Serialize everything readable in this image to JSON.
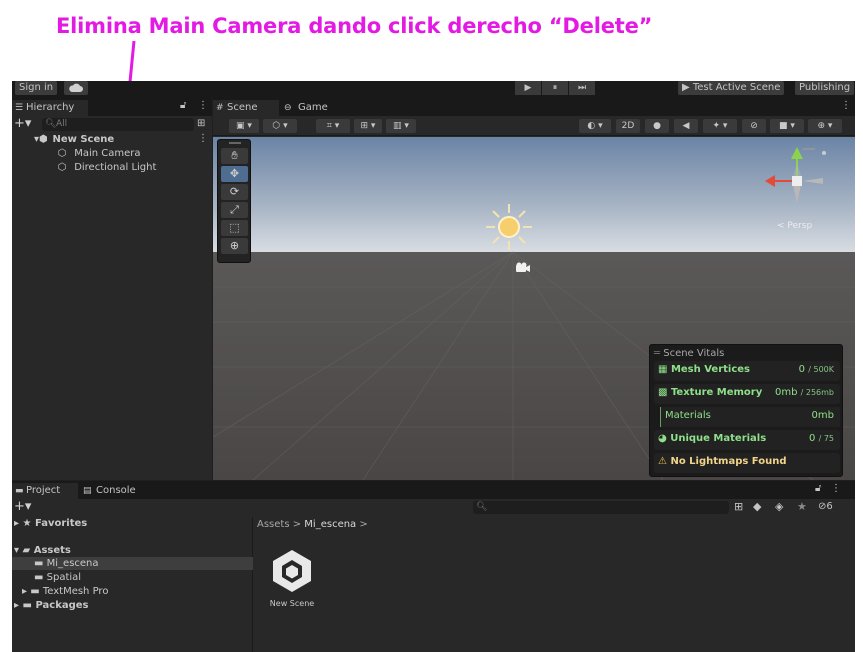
{
  "annotation": {
    "text": "Elimina Main Camera dando click derecho “Delete”",
    "color": "#e31ae3"
  },
  "toolbar": {
    "sign_in": "Sign in",
    "cloud_icon": "cloud-icon",
    "play_icon": "▶",
    "pause_icon": "⏸",
    "step_icon": "⏭",
    "test_active_scene": "Test Active Scene",
    "publishing": "Publishing"
  },
  "hierarchy": {
    "tab_label": "Hierarchy",
    "search_placeholder": "All",
    "scene_name": "New Scene",
    "items": [
      {
        "label": "Main Camera",
        "icon": "cube-icon"
      },
      {
        "label": "Directional Light",
        "icon": "cube-icon"
      }
    ]
  },
  "scene": {
    "tabs": [
      {
        "label": "Scene",
        "icon": "grid-icon"
      },
      {
        "label": "Game",
        "icon": "gamepad-icon"
      }
    ],
    "toolbar_2d": "2D",
    "persp_label": "Persp",
    "tools": [
      "hand-tool",
      "move-tool",
      "rotate-tool",
      "scale-tool",
      "rect-tool",
      "transform-tool"
    ]
  },
  "vitals": {
    "title": "Scene Vitals",
    "rows": [
      {
        "label": "Mesh Vertices",
        "value": "0",
        "sub": "/ 500K",
        "icon": "grid-icon"
      },
      {
        "label": "Texture Memory",
        "value": "0mb",
        "sub": "/ 256mb",
        "icon": "checker-icon"
      },
      {
        "label": "Materials",
        "value": "0mb",
        "sub": "",
        "icon": ""
      },
      {
        "label": "Unique Materials",
        "value": "0",
        "sub": "/ 75",
        "icon": "sphere-icon"
      },
      {
        "label": "No Lightmaps Found",
        "value": "",
        "sub": "",
        "icon": "warning-icon"
      }
    ],
    "accent_color": "#8fe08a"
  },
  "project": {
    "tabs": [
      {
        "label": "Project",
        "icon": "folder-icon"
      },
      {
        "label": "Console",
        "icon": "console-icon"
      }
    ],
    "favorites": "Favorites",
    "assets": "Assets",
    "folders": [
      "Mi_escena",
      "Spatial",
      "TextMesh Pro"
    ],
    "packages": "Packages",
    "breadcrumb": [
      "Assets",
      "Mi_escena"
    ],
    "asset_name": "New Scene",
    "hidden_count": "6"
  }
}
